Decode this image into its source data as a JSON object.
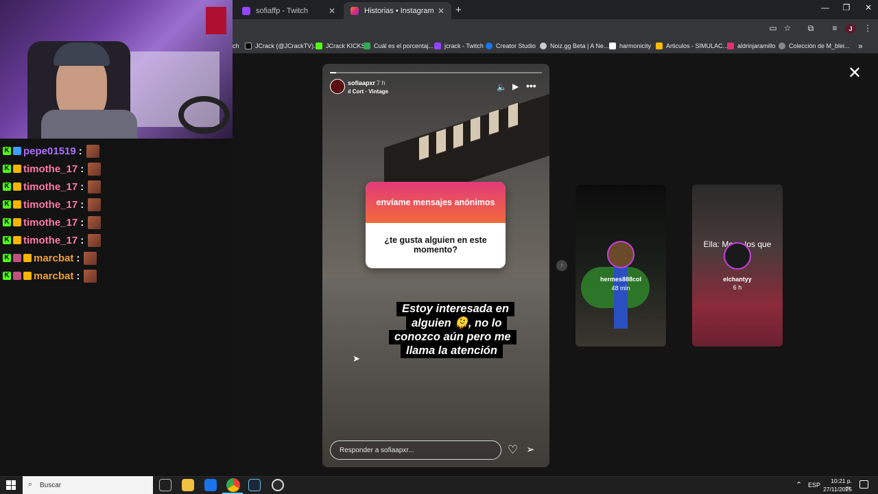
{
  "browser": {
    "tabs": [
      {
        "label": "sofiaffp - Twitch",
        "color": "#9146ff"
      },
      {
        "label": "Historias • Instagram",
        "color": "#e1306c"
      }
    ],
    "new_tab": "+",
    "window_controls": [
      "—",
      "❐",
      "✕"
    ],
    "bookmarks": [
      {
        "label": "ch",
        "color": "#9146ff"
      },
      {
        "label": "JCrack (@JCrackTV)...",
        "color": "#ffffff"
      },
      {
        "label": "JCrack KICKS",
        "color": "#53fc18"
      },
      {
        "label": "Cuál es el porcentaj...",
        "color": "#34a853"
      },
      {
        "label": "jcrack - Twitch",
        "color": "#9146ff"
      },
      {
        "label": "Creator Studio",
        "color": "#1877f2"
      },
      {
        "label": "Noiz.gg Beta | A Ne...",
        "color": "#cccccc"
      },
      {
        "label": "harmonicity",
        "color": "#ffffff"
      },
      {
        "label": "Articulos - SIMULAC...",
        "color": "#fbbc04"
      },
      {
        "label": "aldrinjaramillo",
        "color": "#e1306c"
      },
      {
        "label": "Colección de M_blei...",
        "color": "#888888"
      }
    ],
    "bookmarks_more": "»"
  },
  "chat": {
    "messages": [
      {
        "user": "pepe01519",
        "sep": ":",
        "color": "#a970ff"
      },
      {
        "user": "timothe_17",
        "sep": ":",
        "color": "#ff7aa8"
      },
      {
        "user": "timothe_17",
        "sep": ":",
        "color": "#ff7aa8"
      },
      {
        "user": "timothe_17",
        "sep": ":",
        "color": "#ff7aa8"
      },
      {
        "user": "timothe_17",
        "sep": ":",
        "color": "#ff7aa8"
      },
      {
        "user": "timothe_17",
        "sep": ":",
        "color": "#ff7aa8"
      },
      {
        "user": "marcbat",
        "sep": ":",
        "color": "#f0a030"
      },
      {
        "user": "marcbat",
        "sep": ":",
        "color": "#f0a030"
      }
    ]
  },
  "story": {
    "username": "sofiaapxr",
    "time": "7 h",
    "music": "Cort · Vintage",
    "question_header": "envíame mensajes anónimos",
    "question_text": "¿te gusta alguien en este momento?",
    "caption_lines": [
      "Estoy interesada en",
      "alguien 🫠, no lo",
      "conozco aún pero me",
      "llama la atención"
    ],
    "reply_placeholder": "Responder a sofiaapxr...",
    "close_label": "✕"
  },
  "previews": [
    {
      "user": "hermes888col",
      "time": "48 min"
    },
    {
      "user": "elchantyy",
      "time": "6 h",
      "overlay_text": "Ella: Me ... los que ba... sa"
    }
  ],
  "taskbar": {
    "search_placeholder": "Buscar",
    "language": "ESP",
    "time": "10:21 p. m.",
    "date": "27/11/2025"
  }
}
